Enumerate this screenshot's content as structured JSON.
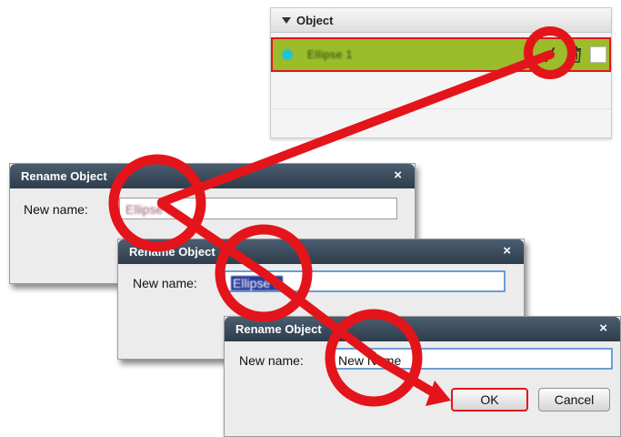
{
  "object_panel": {
    "title": "Object",
    "item_name": "Ellipse 1",
    "item_color": "#24c4cf",
    "row_color": "#9bbc2b"
  },
  "dialog1": {
    "title": "Rename Object",
    "label": "New name:",
    "value": "Ellipse 1"
  },
  "dialog2": {
    "title": "Rename Object",
    "label": "New name:",
    "value": "Ellipse 1"
  },
  "dialog3": {
    "title": "Rename Object",
    "label": "New name:",
    "value": "New Name",
    "ok_label": "OK",
    "cancel_label": "Cancel"
  },
  "colors": {
    "annotation_red": "#e4141b",
    "titlebar": "#3a4a5b",
    "focus_border": "#6c9ed6"
  }
}
